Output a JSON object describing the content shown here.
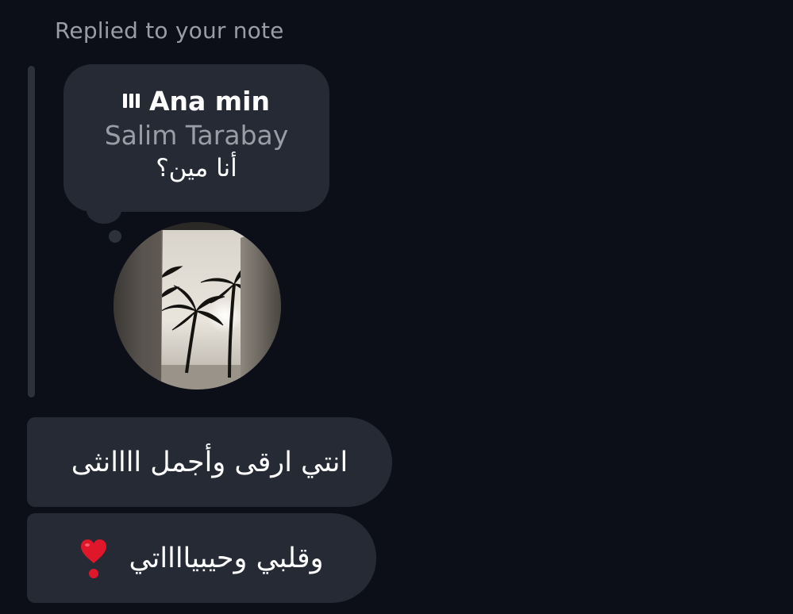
{
  "reply_header": "Replied to your note",
  "note": {
    "icon": "music-bars-icon",
    "song_title": "Ana min",
    "song_artist": "Salim Tarabay",
    "text": "أنا مين؟"
  },
  "avatar": {
    "description_icon": "profile-photo"
  },
  "messages": [
    {
      "text": "انتي ارقى وأجمل اااانثى"
    },
    {
      "text": "وقلبي وحيبيااااتي",
      "emoji_icon": "heart-exclamation-icon"
    }
  ],
  "colors": {
    "background": "#0c0f18",
    "bubble": "#262a34",
    "muted_text": "#9a9da6",
    "heart": "#e0162b"
  }
}
